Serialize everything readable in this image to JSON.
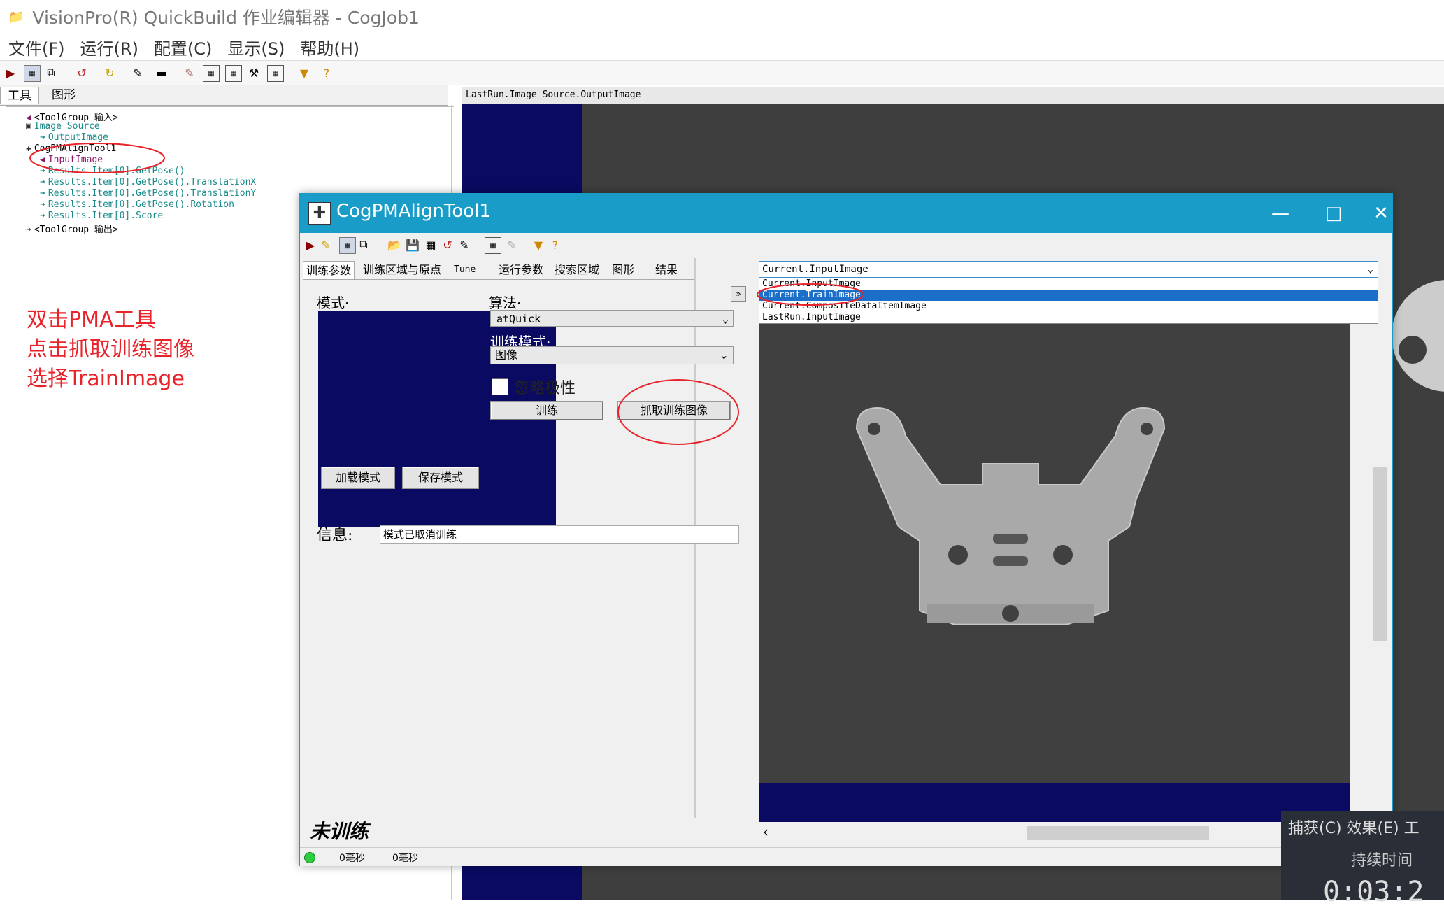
{
  "app": {
    "title": "VisionPro(R) QuickBuild 作业编辑器 - CogJob1",
    "menu": [
      "文件(F)",
      "运行(R)",
      "配置(C)",
      "显示(S)",
      "帮助(H)"
    ]
  },
  "left_panel": {
    "tabs": [
      "工具",
      "图形"
    ],
    "tree": [
      "<ToolGroup 输入>",
      "Image Source",
      "OutputImage",
      "CogPMAlignTool1",
      "InputImage",
      "Results.Item[0].GetPose()",
      "Results.Item[0].GetPose().TranslationX",
      "Results.Item[0].GetPose().TranslationY",
      "Results.Item[0].GetPose().Rotation",
      "Results.Item[0].Score",
      "<ToolGroup 输出>"
    ]
  },
  "annotation": [
    "双击PMA工具",
    "点击抓取训练图像",
    "选择TrainImage"
  ],
  "image_view": {
    "header": "LastRun.Image Source.OutputImage"
  },
  "dialog": {
    "title": "CogPMAlignTool1",
    "tabs": [
      "训练参数",
      "训练区域与原点",
      "Tune",
      "运行参数",
      "搜索区域",
      "图形",
      "结果"
    ],
    "pattern_label": "模式·",
    "algorithm_label": "算法·",
    "algorithm_value": "atQuick",
    "train_mode_label": "训练模式·",
    "train_mode_value": "图像",
    "ignore_polarity": "忽略极性",
    "train_button": "训练",
    "grab_button": "抓取训练图像",
    "load_button": "加载模式",
    "save_button": "保存模式",
    "info_label": "信息:",
    "info_value": "模式已取消训练",
    "status": "未训练",
    "image_combo": "Current.InputImage",
    "image_options": [
      "Current.InputImage",
      "Current.TrainImage",
      "Current.CompositeDataItemImage",
      "LastRun.InputImage"
    ],
    "status_times": [
      "0毫秒",
      "0毫秒"
    ]
  },
  "recorder": {
    "menu": "捕获(C) 效果(E) 工",
    "label": "持续时间",
    "time": "0:03:2"
  }
}
